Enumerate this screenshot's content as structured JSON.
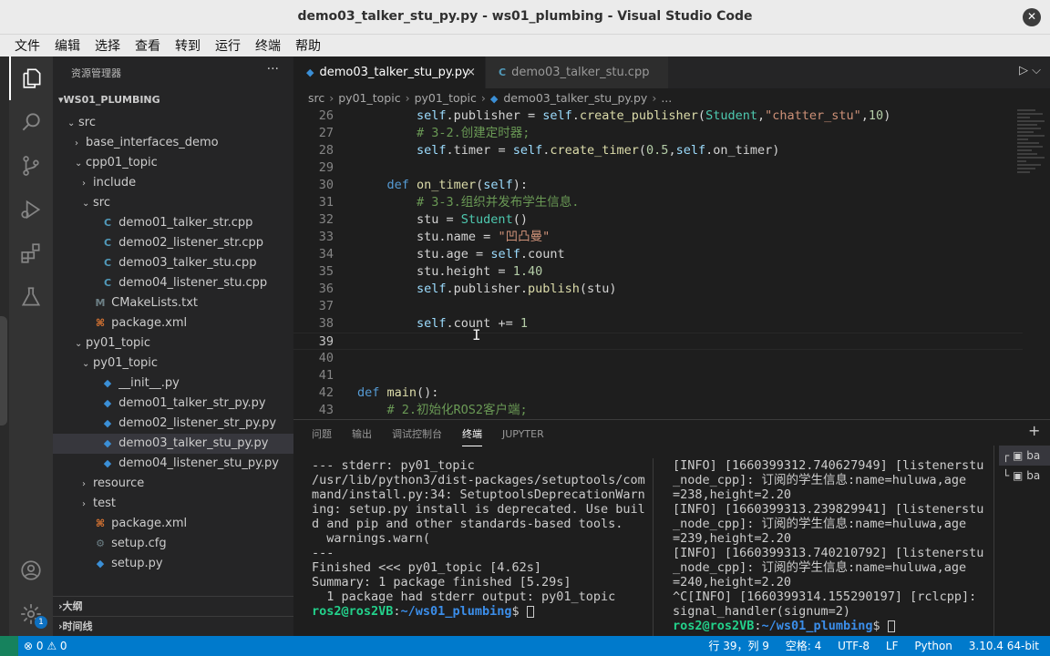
{
  "window": {
    "title": "demo03_talker_stu_py.py - ws01_plumbing - Visual Studio Code",
    "close_glyph": "✕"
  },
  "menu": [
    "文件",
    "编辑",
    "选择",
    "查看",
    "转到",
    "运行",
    "终端",
    "帮助"
  ],
  "activity": {
    "badge": "1"
  },
  "sidebar": {
    "header": "资源管理器",
    "more": "···",
    "root": "WS01_PLUMBING",
    "items": [
      {
        "label": "src",
        "indent": 1,
        "kind": "folder-open"
      },
      {
        "label": "base_interfaces_demo",
        "indent": 2,
        "kind": "folder"
      },
      {
        "label": "cpp01_topic",
        "indent": 2,
        "kind": "folder-open"
      },
      {
        "label": "include",
        "indent": 3,
        "kind": "folder"
      },
      {
        "label": "src",
        "indent": 3,
        "kind": "folder-open"
      },
      {
        "label": "demo01_talker_str.cpp",
        "indent": 4,
        "kind": "cpp"
      },
      {
        "label": "demo02_listener_str.cpp",
        "indent": 4,
        "kind": "cpp"
      },
      {
        "label": "demo03_talker_stu.cpp",
        "indent": 4,
        "kind": "cpp"
      },
      {
        "label": "demo04_listener_stu.cpp",
        "indent": 4,
        "kind": "cpp"
      },
      {
        "label": "CMakeLists.txt",
        "indent": 3,
        "kind": "cmake"
      },
      {
        "label": "package.xml",
        "indent": 3,
        "kind": "xml"
      },
      {
        "label": "py01_topic",
        "indent": 2,
        "kind": "folder-open"
      },
      {
        "label": "py01_topic",
        "indent": 3,
        "kind": "folder-open"
      },
      {
        "label": "__init__.py",
        "indent": 4,
        "kind": "py"
      },
      {
        "label": "demo01_talker_str_py.py",
        "indent": 4,
        "kind": "py"
      },
      {
        "label": "demo02_listener_str_py.py",
        "indent": 4,
        "kind": "py"
      },
      {
        "label": "demo03_talker_stu_py.py",
        "indent": 4,
        "kind": "py",
        "selected": true
      },
      {
        "label": "demo04_listener_stu_py.py",
        "indent": 4,
        "kind": "py"
      },
      {
        "label": "resource",
        "indent": 3,
        "kind": "folder"
      },
      {
        "label": "test",
        "indent": 3,
        "kind": "folder"
      },
      {
        "label": "package.xml",
        "indent": 3,
        "kind": "xml"
      },
      {
        "label": "setup.cfg",
        "indent": 3,
        "kind": "cfg"
      },
      {
        "label": "setup.py",
        "indent": 3,
        "kind": "py"
      }
    ],
    "outline": "大纲",
    "timeline": "时间线"
  },
  "tabs": [
    {
      "label": "demo03_talker_stu_py.py",
      "active": true,
      "close": "×"
    },
    {
      "label": "demo03_talker_stu.cpp",
      "active": false
    }
  ],
  "tab_actions": "▷ ⌵",
  "breadcrumb": [
    "src",
    "py01_topic",
    "py01_topic",
    "demo03_talker_stu_py.py",
    "..."
  ],
  "code": [
    {
      "n": "26",
      "html": "        <span class=\"v\">self</span>.publisher = <span class=\"v\">self</span>.<span class=\"f\">create_publisher</span>(<span class=\"t\">Student</span>,<span class=\"s\">\"chatter_stu\"</span>,<span class=\"n\">10</span>)"
    },
    {
      "n": "27",
      "html": "        <span class=\"c\"># 3-2.创建定时器;</span>"
    },
    {
      "n": "28",
      "html": "        <span class=\"v\">self</span>.timer = <span class=\"v\">self</span>.<span class=\"f\">create_timer</span>(<span class=\"n\">0.5</span>,<span class=\"v\">self</span>.on_timer)"
    },
    {
      "n": "29",
      "html": ""
    },
    {
      "n": "30",
      "html": "    <span class=\"k\">def</span> <span class=\"f\">on_timer</span>(<span class=\"v\">self</span>):"
    },
    {
      "n": "31",
      "html": "        <span class=\"c\"># 3-3.组织并发布学生信息.</span>"
    },
    {
      "n": "32",
      "html": "        stu = <span class=\"t\">Student</span>()"
    },
    {
      "n": "33",
      "html": "        stu.name = <span class=\"s\">\"凹凸曼\"</span>"
    },
    {
      "n": "34",
      "html": "        stu.age = <span class=\"v\">self</span>.count"
    },
    {
      "n": "35",
      "html": "        stu.height = <span class=\"n\">1.40</span>"
    },
    {
      "n": "36",
      "html": "        <span class=\"v\">self</span>.publisher.<span class=\"f\">publish</span>(stu)"
    },
    {
      "n": "37",
      "html": ""
    },
    {
      "n": "38",
      "html": "        <span class=\"v\">self</span>.count += <span class=\"n\">1</span>"
    },
    {
      "n": "39",
      "html": "",
      "current": true
    },
    {
      "n": "40",
      "html": ""
    },
    {
      "n": "41",
      "html": ""
    },
    {
      "n": "42",
      "html": "<span class=\"k\">def</span> <span class=\"f\">main</span>():"
    },
    {
      "n": "43",
      "html": "    <span class=\"c\"># 2.初始化ROS2客户端;</span>"
    }
  ],
  "panel": {
    "tabs": [
      "问题",
      "输出",
      "调试控制台",
      "终端",
      "JUPYTER"
    ],
    "active_tab": "终端",
    "add": "+",
    "left_terminal": [
      "--- stderr: py01_topic",
      "/usr/lib/python3/dist-packages/setuptools/com",
      "mand/install.py:34: SetuptoolsDeprecationWarn",
      "ing: setup.py install is deprecated. Use buil",
      "d and pip and other standards-based tools.",
      "  warnings.warn(",
      "---",
      "Finished <<< py01_topic [4.62s]",
      "",
      "Summary: 1 package finished [5.29s]",
      "  1 package had stderr output: py01_topic"
    ],
    "right_terminal": [
      "[INFO] [1660399312.740627949] [listenerstu",
      "_node_cpp]: 订阅的学生信息:name=huluwa,age",
      "=238,height=2.20",
      "[INFO] [1660399313.239829941] [listenerstu",
      "_node_cpp]: 订阅的学生信息:name=huluwa,age",
      "=239,height=2.20",
      "[INFO] [1660399313.740210792] [listenerstu",
      "_node_cpp]: 订阅的学生信息:name=huluwa,age",
      "=240,height=2.20",
      "^C[INFO] [1660399314.155290197] [rclcpp]:",
      "signal_handler(signum=2)"
    ],
    "prompt_user": "ros2@ros2VB",
    "prompt_path": "~/ws01_plumbing",
    "prompt_sep": ":",
    "prompt_tail": "$ ",
    "terminal_list": [
      "ba",
      "ba"
    ]
  },
  "status": {
    "left": "⊗ 0 ⚠ 0",
    "position": "行 39，列 9",
    "spaces": "空格: 4",
    "encoding": "UTF-8",
    "eol": "LF",
    "language": "Python",
    "interpreter": "3.10.4 64-bit"
  }
}
